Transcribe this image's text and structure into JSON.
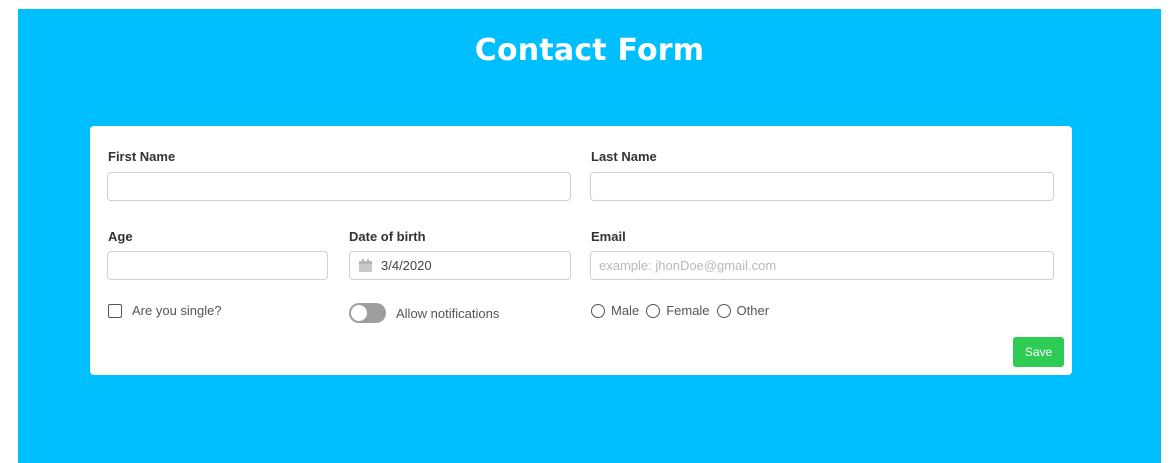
{
  "page": {
    "title": "Contact Form"
  },
  "form": {
    "first_name_label": "First Name",
    "first_name_value": "",
    "last_name_label": "Last Name",
    "last_name_value": "",
    "age_label": "Age",
    "age_value": "",
    "dob_label": "Date of birth",
    "dob_value": "3/4/2020",
    "email_label": "Email",
    "email_value": "",
    "email_placeholder": "example: jhonDoe@gmail.com",
    "single_label": "Are you single?",
    "single_checked": false,
    "notifications_label": "Allow notifications",
    "notifications_on": false,
    "gender_options": [
      "Male",
      "Female",
      "Other"
    ],
    "save_label": "Save"
  },
  "colors": {
    "background": "#00bfff",
    "save_button": "#2ecc55",
    "toggle_off": "#9e9e9e"
  },
  "icons": {
    "date": "calendar-icon"
  }
}
